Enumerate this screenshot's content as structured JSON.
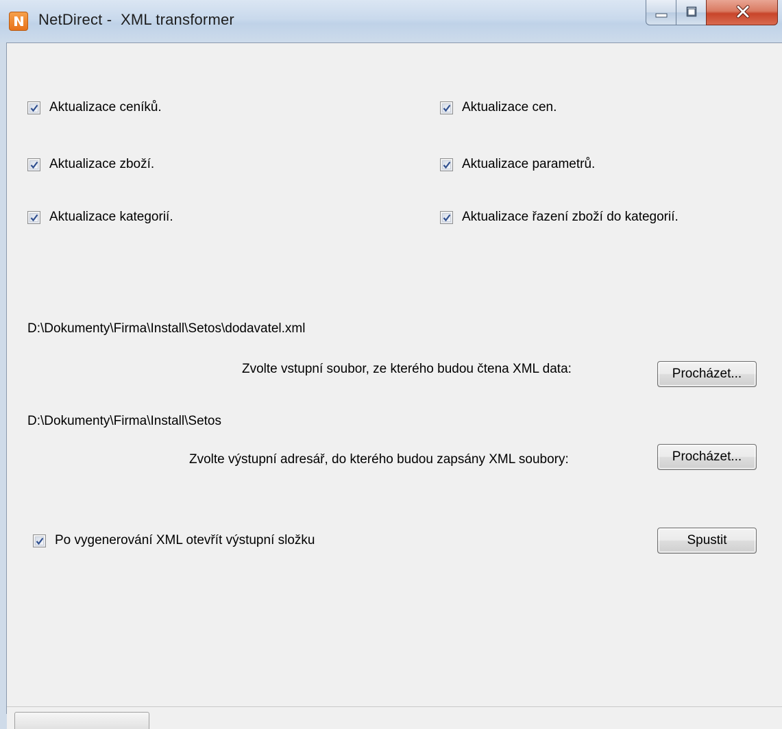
{
  "window": {
    "title": "NetDirect -  XML transformer",
    "icon": "netdirect-app-icon",
    "caption_buttons": [
      "minimize-icon",
      "maximize-icon",
      "close-icon"
    ]
  },
  "options": {
    "left": [
      {
        "label": "Aktualizace ceníků.",
        "checked": true
      },
      {
        "label": "Aktualizace zboží.",
        "checked": true
      },
      {
        "label": "Aktualizace kategorií.",
        "checked": true
      }
    ],
    "right": [
      {
        "label": "Aktualizace cen.",
        "checked": true
      },
      {
        "label": "Aktualizace parametrů.",
        "checked": true
      },
      {
        "label": "Aktualizace řazení zboží do kategorií.",
        "checked": true
      }
    ]
  },
  "input_file": {
    "path": "D:\\Dokumenty\\Firma\\Install\\Setos\\dodavatel.xml",
    "prompt": "Zvolte vstupní soubor, ze kterého budou čtena XML data:",
    "browse_label": "Procházet..."
  },
  "output_dir": {
    "path": "D:\\Dokumenty\\Firma\\Install\\Setos",
    "prompt": "Zvolte výstupní adresář, do kterého budou zapsány XML soubory:",
    "browse_label": "Procházet..."
  },
  "open_folder": {
    "label": "Po vygenerování XML otevřít výstupní složku",
    "checked": true
  },
  "run_label": "Spustit",
  "colors": {
    "checkmark": "#2f4f8f",
    "client_bg": "#f0f0f0",
    "close_button": "#c8452b"
  }
}
